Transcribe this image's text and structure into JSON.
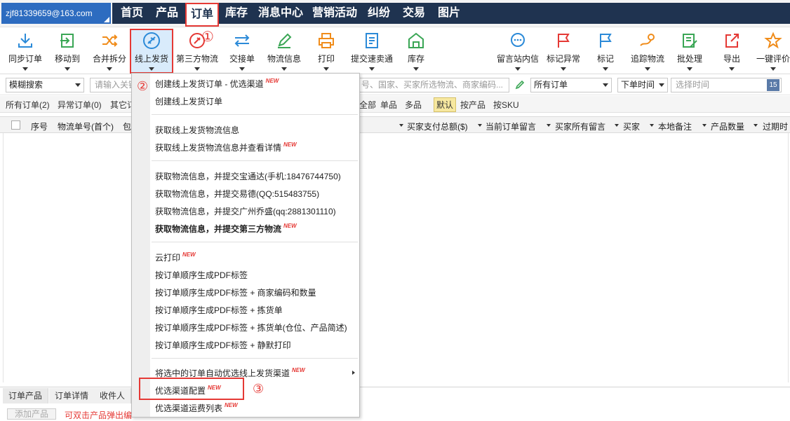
{
  "account": "zjf81339659@163.com",
  "nav": [
    "首页",
    "产品",
    "订单",
    "库存",
    "消息中心",
    "营销活动",
    "纠纷",
    "交易",
    "图片"
  ],
  "toolbar_left": [
    {
      "label": "同步订单",
      "icon": "download-icon"
    },
    {
      "label": "移动到",
      "icon": "move-to-icon"
    },
    {
      "label": "合并拆分",
      "icon": "shuffle-icon"
    },
    {
      "label": "线上发货",
      "icon": "plane-icon"
    },
    {
      "label": "第三方物流",
      "icon": "third-party-icon"
    },
    {
      "label": "交接单",
      "icon": "swap-arrows-icon"
    },
    {
      "label": "物流信息",
      "icon": "pen-icon"
    },
    {
      "label": "打印",
      "icon": "printer-icon"
    },
    {
      "label": "提交速卖通",
      "icon": "document-icon"
    },
    {
      "label": "库存",
      "icon": "warehouse-icon"
    }
  ],
  "toolbar_right": [
    {
      "label": "留言站内信",
      "icon": "chat-icon"
    },
    {
      "label": "标记异常",
      "icon": "red-flag-icon"
    },
    {
      "label": "标记",
      "icon": "blue-flag-icon"
    },
    {
      "label": "追踪物流",
      "icon": "tracking-icon"
    },
    {
      "label": "批处理",
      "icon": "batch-edit-icon"
    },
    {
      "label": "导出",
      "icon": "export-icon"
    },
    {
      "label": "一键评价",
      "icon": "rating-icon"
    }
  ],
  "annotations": {
    "circle1": "①",
    "circle2": "②",
    "circle3": "③"
  },
  "search": {
    "mode": "模糊搜索",
    "keyword_placeholder": "请输入关键",
    "fields_placeholder": "号、国家、买家所选物流、商家编码...",
    "order_filter": "所有订单",
    "time_field": "下单时间",
    "time_placeholder": "选择时间",
    "calendar_day": "15"
  },
  "filters": {
    "all_orders": "所有订单(2)",
    "abnormal_orders": "异常订单(0)",
    "other": "其它订",
    "all": "全部",
    "single": "单品",
    "multi": "多品",
    "default": "默认",
    "by_product": "按产品",
    "by_sku": "按SKU"
  },
  "columns_left": [
    "序号",
    "物流单号(首个)",
    "包"
  ],
  "columns_right": [
    "买家支付总额($)",
    "当前订单留言",
    "买家所有留言",
    "买家",
    "本地备注",
    "产品数量",
    "过期时"
  ],
  "bottom": {
    "tabs": [
      "订单产品",
      "订单详情",
      "收件人"
    ],
    "add_product": "添加产品",
    "hint": "可双击产品弹出编"
  },
  "menu": {
    "new_badge": "NEW",
    "items": [
      {
        "label": "创建线上发货订单 - 优选渠道",
        "new": true,
        "bold": false
      },
      {
        "label": "创建线上发货订单",
        "new": false,
        "bold": false
      },
      {
        "label": "获取线上发货物流信息",
        "new": false,
        "bold": false
      },
      {
        "label": "获取线上发货物流信息并查看详情",
        "new": true,
        "bold": false
      },
      {
        "label": "获取物流信息，并提交宝通达(手机:18476744750)",
        "new": false,
        "bold": false
      },
      {
        "label": "获取物流信息，并提交易德(QQ:515483755)",
        "new": false,
        "bold": false
      },
      {
        "label": "获取物流信息，并提交广州乔盛(qq:2881301110)",
        "new": false,
        "bold": false
      },
      {
        "label": "获取物流信息，并提交第三方物流",
        "new": true,
        "bold": true
      },
      {
        "label": "云打印",
        "new": true,
        "bold": false
      },
      {
        "label": "按订单顺序生成PDF标签",
        "new": false,
        "bold": false
      },
      {
        "label": "按订单顺序生成PDF标签 + 商家编码和数量",
        "new": false,
        "bold": false
      },
      {
        "label": "按订单顺序生成PDF标签 + 拣货单",
        "new": false,
        "bold": false
      },
      {
        "label": "按订单顺序生成PDF标签 + 拣货单(仓位、产品简述)",
        "new": false,
        "bold": false
      },
      {
        "label": "按订单顺序生成PDF标签 + 静默打印",
        "new": false,
        "bold": false
      },
      {
        "label": "将选中的订单自动优选线上发货渠道",
        "new": true,
        "bold": false,
        "submenu": true
      },
      {
        "label": "优选渠道配置",
        "new": true,
        "bold": false
      },
      {
        "label": "优选渠道运费列表",
        "new": true,
        "bold": false
      }
    ]
  }
}
